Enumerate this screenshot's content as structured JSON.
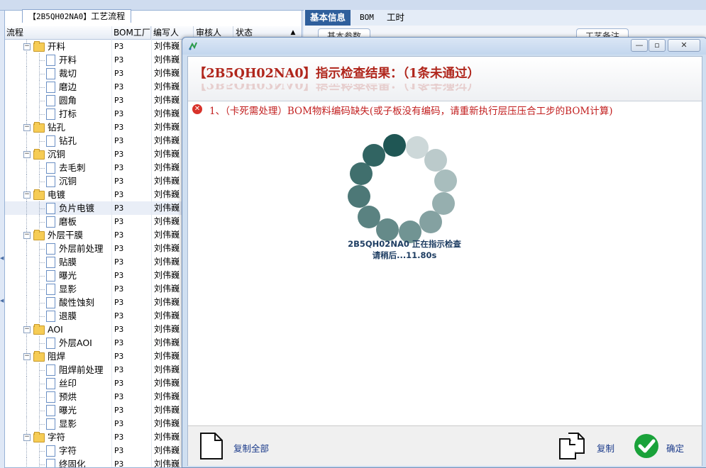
{
  "left_panel": {
    "tab_title_code": "【2B5QH02NA0】",
    "tab_title_text": "工艺流程",
    "columns": [
      "流程",
      "BOM工厂",
      "编写人",
      "审核人",
      "状态"
    ],
    "rows": [
      {
        "label": "开料",
        "level": 0,
        "type": "folder",
        "bom": "P3",
        "author": "刘伟巍"
      },
      {
        "label": "开料",
        "level": 1,
        "type": "doc",
        "bom": "P3",
        "author": "刘伟巍"
      },
      {
        "label": "裁切",
        "level": 1,
        "type": "doc",
        "bom": "P3",
        "author": "刘伟巍"
      },
      {
        "label": "磨边",
        "level": 1,
        "type": "doc",
        "bom": "P3",
        "author": "刘伟巍"
      },
      {
        "label": "圆角",
        "level": 1,
        "type": "doc",
        "bom": "P3",
        "author": "刘伟巍"
      },
      {
        "label": "打标",
        "level": 1,
        "type": "doc",
        "bom": "P3",
        "author": "刘伟巍"
      },
      {
        "label": "钻孔",
        "level": 0,
        "type": "folder",
        "bom": "P3",
        "author": "刘伟巍"
      },
      {
        "label": "钻孔",
        "level": 1,
        "type": "doc",
        "bom": "P3",
        "author": "刘伟巍"
      },
      {
        "label": "沉铜",
        "level": 0,
        "type": "folder",
        "bom": "P3",
        "author": "刘伟巍"
      },
      {
        "label": "去毛刺",
        "level": 1,
        "type": "doc",
        "bom": "P3",
        "author": "刘伟巍"
      },
      {
        "label": "沉铜",
        "level": 1,
        "type": "doc",
        "bom": "P3",
        "author": "刘伟巍"
      },
      {
        "label": "电镀",
        "level": 0,
        "type": "folder",
        "bom": "P3",
        "author": "刘伟巍"
      },
      {
        "label": "负片电镀",
        "level": 1,
        "type": "doc",
        "bom": "P3",
        "author": "刘伟巍",
        "selected": true
      },
      {
        "label": "磨板",
        "level": 1,
        "type": "doc",
        "bom": "P3",
        "author": "刘伟巍"
      },
      {
        "label": "外层干膜",
        "level": 0,
        "type": "folder",
        "bom": "P3",
        "author": "刘伟巍"
      },
      {
        "label": "外层前处理",
        "level": 1,
        "type": "doc",
        "bom": "P3",
        "author": "刘伟巍"
      },
      {
        "label": "贴膜",
        "level": 1,
        "type": "doc",
        "bom": "P3",
        "author": "刘伟巍"
      },
      {
        "label": "曝光",
        "level": 1,
        "type": "doc",
        "bom": "P3",
        "author": "刘伟巍"
      },
      {
        "label": "显影",
        "level": 1,
        "type": "doc",
        "bom": "P3",
        "author": "刘伟巍"
      },
      {
        "label": "酸性蚀刻",
        "level": 1,
        "type": "doc",
        "bom": "P3",
        "author": "刘伟巍"
      },
      {
        "label": "退膜",
        "level": 1,
        "type": "doc",
        "bom": "P3",
        "author": "刘伟巍"
      },
      {
        "label": "AOI",
        "level": 0,
        "type": "folder",
        "bom": "P3",
        "author": "刘伟巍"
      },
      {
        "label": "外层AOI",
        "level": 1,
        "type": "doc",
        "bom": "P3",
        "author": "刘伟巍"
      },
      {
        "label": "阻焊",
        "level": 0,
        "type": "folder",
        "bom": "P3",
        "author": "刘伟巍"
      },
      {
        "label": "阻焊前处理",
        "level": 1,
        "type": "doc",
        "bom": "P3",
        "author": "刘伟巍"
      },
      {
        "label": "丝印",
        "level": 1,
        "type": "doc",
        "bom": "P3",
        "author": "刘伟巍"
      },
      {
        "label": "预烘",
        "level": 1,
        "type": "doc",
        "bom": "P3",
        "author": "刘伟巍"
      },
      {
        "label": "曝光",
        "level": 1,
        "type": "doc",
        "bom": "P3",
        "author": "刘伟巍"
      },
      {
        "label": "显影",
        "level": 1,
        "type": "doc",
        "bom": "P3",
        "author": "刘伟巍"
      },
      {
        "label": "字符",
        "level": 0,
        "type": "folder",
        "bom": "P3",
        "author": "刘伟巍"
      },
      {
        "label": "字符",
        "level": 1,
        "type": "doc",
        "bom": "P3",
        "author": "刘伟巍"
      },
      {
        "label": "终固化",
        "level": 1,
        "type": "doc",
        "bom": "P3",
        "author": "刘伟巍"
      }
    ]
  },
  "right_area": {
    "tabs": [
      "基本信息",
      "BOM",
      "工时"
    ],
    "active_tab": "基本信息",
    "sub_tabs": [
      "基本参数",
      "工艺备注"
    ]
  },
  "dialog": {
    "heading": "【2B5QH02NA0】指示检查结果：（1条未通过）",
    "error_index": "1、",
    "error_text": "（卡死需处理）BOM物料编码缺失(或子板没有编码，请重新执行层压压合工步的BOM计算)",
    "loading_line1": "2B5QH02NA0 正在指示检查",
    "loading_line2": "请稍后...11.80s",
    "buttons": {
      "copy_all": "复制全部",
      "copy": "复制",
      "confirm": "确定"
    },
    "window_controls": [
      "minimize",
      "restore",
      "close"
    ]
  },
  "colors": {
    "heading_red": "#b0261c",
    "spinner_dark": "#1f5654",
    "spinner_light": "#d6dfe0",
    "confirm_green": "#1aa23a",
    "active_tab_blue": "#2f5f9c"
  }
}
